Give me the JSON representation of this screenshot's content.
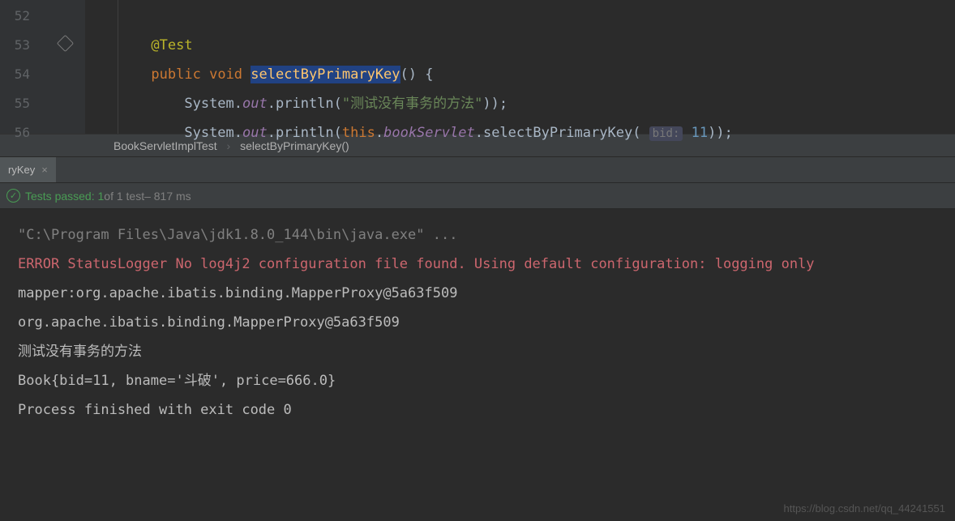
{
  "code": {
    "lines": [
      {
        "num": "52",
        "content": []
      },
      {
        "num": "53",
        "content": []
      },
      {
        "num": "54",
        "content": [],
        "run_icon": true
      },
      {
        "num": "55",
        "content": []
      },
      {
        "num": "56",
        "content": []
      }
    ],
    "annotation": "@Test",
    "keywords": {
      "public": "public",
      "void": "void",
      "this": "this"
    },
    "method_name": "selectByPrimaryKey",
    "paren_open": "() {",
    "sys": "System",
    "out": "out",
    "println": "println",
    "str1": "\"测试没有事务的方法\"",
    "field1": "bookServlet",
    "call1": "selectByPrimaryKey",
    "hint_label": "bid:",
    "hint_val": "11",
    "close1": ");",
    "close2": "));"
  },
  "breadcrumb": {
    "item1": "BookServletImplTest",
    "item2": "selectByPrimaryKey()",
    "sep": "›"
  },
  "tab": {
    "label": "ryKey",
    "close": "×"
  },
  "test_status": {
    "passed": "Tests passed: 1",
    "of": " of 1 test",
    "time": " – 817 ms"
  },
  "console": {
    "line1": "\"C:\\Program Files\\Java\\jdk1.8.0_144\\bin\\java.exe\" ...",
    "line2": "ERROR StatusLogger No log4j2 configuration file found. Using default configuration: logging only",
    "line3": "mapper:org.apache.ibatis.binding.MapperProxy@5a63f509",
    "line4": "org.apache.ibatis.binding.MapperProxy@5a63f509",
    "line5": "测试没有事务的方法",
    "line6": "Book{bid=11, bname='斗破', price=666.0}",
    "line7": "",
    "line8": "Process finished with exit code 0"
  },
  "watermark": "https://blog.csdn.net/qq_44241551"
}
